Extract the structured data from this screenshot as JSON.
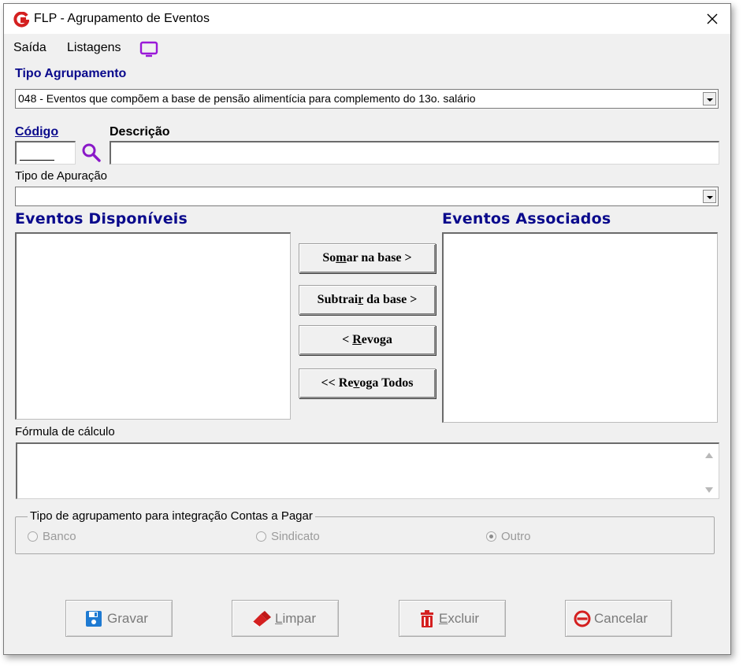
{
  "window": {
    "title": "FLP - Agrupamento de Eventos"
  },
  "menu": {
    "saida": "Saída",
    "listagens": "Listagens"
  },
  "tipo_agrupamento": {
    "label": "Tipo Agrupamento",
    "value": "048 - Eventos que compõem a base de pensão alimentícia para complemento do 13o. salário"
  },
  "codigo": {
    "label": "Código",
    "value": ""
  },
  "descricao": {
    "label": "Descrição",
    "value": ""
  },
  "tipo_apuracao": {
    "label": "Tipo de Apuração",
    "value": ""
  },
  "eventos_disponiveis": {
    "label": "Eventos Disponíveis",
    "items": []
  },
  "eventos_associados": {
    "label": "Eventos Associados",
    "items": []
  },
  "transfer_buttons": {
    "somar": {
      "pre": "So",
      "ul": "m",
      "post": "ar  na base >"
    },
    "subtrair": {
      "pre": "Subtrai",
      "ul": "r",
      "post": " da base >"
    },
    "revoga": {
      "pre": "< ",
      "ul": "R",
      "post": "evoga"
    },
    "revoga_todos": {
      "pre": "<< Re",
      "ul": "v",
      "post": "oga Todos"
    }
  },
  "formula": {
    "label": "Fórmula de cálculo",
    "value": ""
  },
  "integracao": {
    "legend": "Tipo de agrupamento para integração Contas a Pagar",
    "options": [
      {
        "label": "Banco",
        "selected": false
      },
      {
        "label": "Sindicato",
        "selected": false
      },
      {
        "label": "Outro",
        "selected": true
      }
    ]
  },
  "actions": {
    "gravar": {
      "pre": "",
      "ul": "",
      "post": "Gravar"
    },
    "limpar": {
      "pre": "",
      "ul": "L",
      "post": "impar"
    },
    "excluir": {
      "pre": "",
      "ul": "E",
      "post": "xcluir"
    },
    "cancelar": {
      "pre": "",
      "ul": "",
      "post": "Cancelar"
    }
  },
  "colors": {
    "label_blue": "#0a0a8c",
    "icon_red": "#d42020",
    "icon_purple": "#9a18d8",
    "save_blue": "#1e7ad2"
  }
}
